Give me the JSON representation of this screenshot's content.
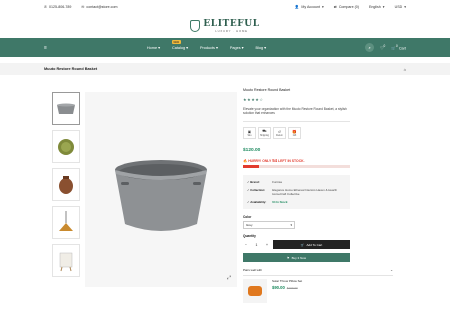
{
  "topbar": {
    "phone": "0125-806-789",
    "email": "contact@store.com",
    "account": "My Account",
    "compare": "Compare (0)",
    "language": "English",
    "currency": "USD"
  },
  "logo": {
    "title": "ELITEFUL",
    "subtitle": "LUXURY · HOME"
  },
  "nav": {
    "items": [
      {
        "label": "Home"
      },
      {
        "label": "Catalog",
        "badge": "NEW"
      },
      {
        "label": "Products"
      },
      {
        "label": "Pages"
      },
      {
        "label": "Blog"
      }
    ],
    "wishlist_count": "0",
    "cart_count": "0",
    "cart_label": "Cart"
  },
  "breadcrumb": {
    "title": "Muuto Restore Round Basket"
  },
  "product": {
    "title": "Muuto Restore Round Basket",
    "rating": 4,
    "description": "Elevate your organization with the Muuto Restore Round Basket, a stylish solution that enhances",
    "features": [
      {
        "icon": "box-icon",
        "label": "Sku"
      },
      {
        "icon": "shipping-icon",
        "label": "Shipping"
      },
      {
        "icon": "return-icon",
        "label": "Return"
      },
      {
        "icon": "gift-icon",
        "label": "Gift"
      }
    ],
    "price": "$120.00",
    "hurry_prefix": "HURRY! ONLY",
    "hurry_count": "54",
    "hurry_suffix": "LEFT IN STOCK.",
    "stock_level": 0.15,
    "brand_key": "Brand:",
    "brand_val": "Furnisa",
    "collection_key": "Collection:",
    "collection_val": "Elegance Home Ethereal Interiors Haven & Hearth HomeCraft Collective",
    "availability_key": "Availability:",
    "availability_val": "64 In Stock",
    "color_label": "Color",
    "color_value": "Grey",
    "quantity_label": "Quantity",
    "quantity": "1",
    "add_to_cart": "Add To Cart",
    "buy_now": "Buy It Now",
    "pair_label": "Pairs well with",
    "related": {
      "name": "Solar Throw Pillow Set",
      "price": "$90.00",
      "old_price": "$100.00"
    }
  },
  "colors": {
    "accent": "#3f7868",
    "price": "#1d8a5f",
    "alert": "#e23b2e"
  }
}
